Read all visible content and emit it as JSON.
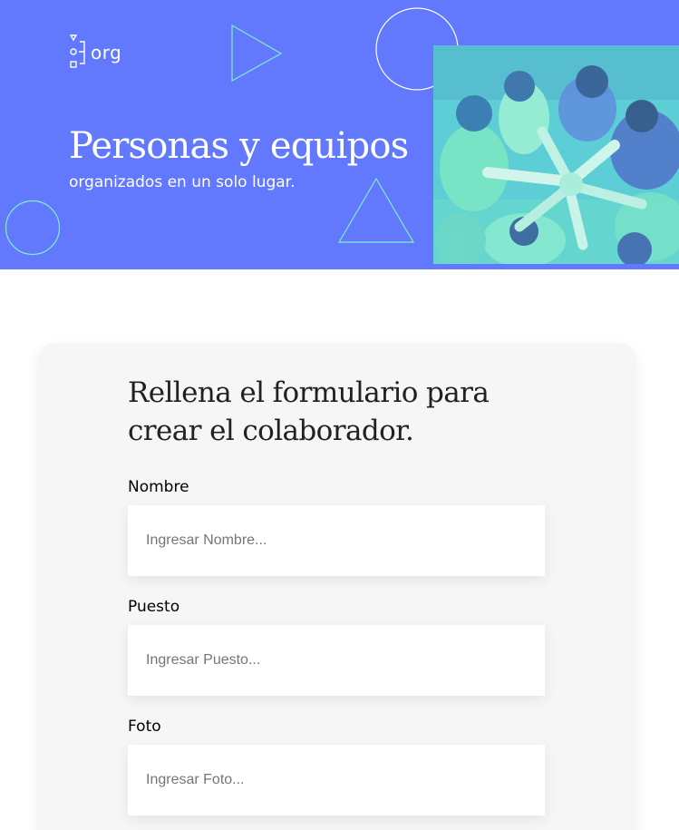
{
  "brand": {
    "logo_text": "org",
    "logo_icon": "org-chart-icon"
  },
  "hero": {
    "title": "Personas y equipos",
    "subtitle": "organizados en un solo lugar.",
    "photo_icon": "team-hands-photo",
    "background_color": "#6278FD",
    "accent_color": "#7FF0C8",
    "photo_tint": "#6BEBD0"
  },
  "form": {
    "title_line1": "Rellena el formulario para",
    "title_line2": "crear el colaborador.",
    "fields": [
      {
        "label": "Nombre",
        "placeholder": "Ingresar Nombre..."
      },
      {
        "label": "Puesto",
        "placeholder": "Ingresar Puesto..."
      },
      {
        "label": "Foto",
        "placeholder": "Ingresar Foto..."
      }
    ]
  }
}
